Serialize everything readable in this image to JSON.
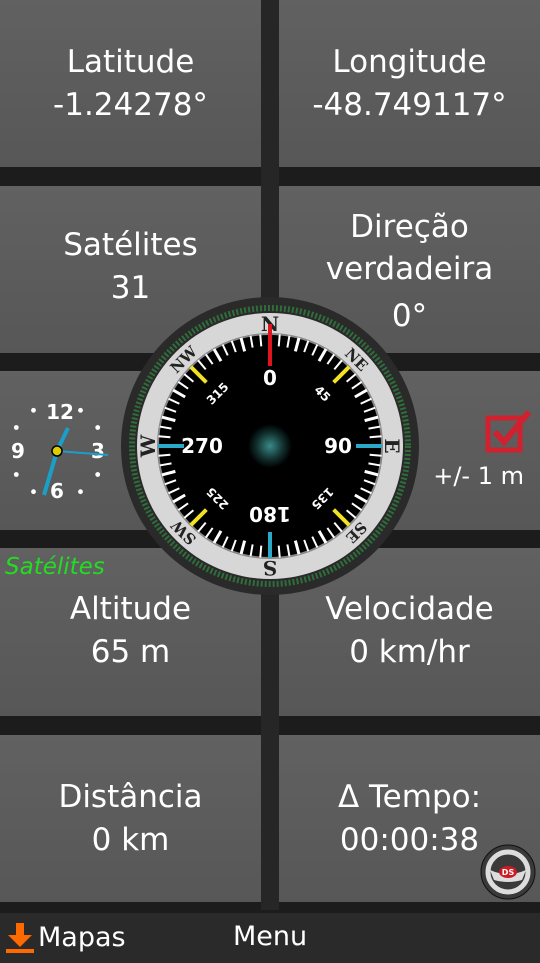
{
  "tiles": {
    "latitude": {
      "label": "Latitude",
      "value": "-1.24278°"
    },
    "longitude": {
      "label": "Longitude",
      "value": "-48.749117°"
    },
    "satellites": {
      "label": "Satélites",
      "value": "31"
    },
    "direction": {
      "label_line1": "Direção",
      "label_line2": "verdadeira",
      "value": "0°"
    },
    "altitude": {
      "label": "Altitude",
      "value": "65 m"
    },
    "speed": {
      "label": "Velocidade",
      "value": "0 km/hr"
    },
    "distance": {
      "label": "Distância",
      "value": "0 km"
    },
    "time": {
      "label": "Δ Tempo:",
      "value": "00:00:38"
    }
  },
  "accuracy": {
    "text": "+/- 1 m",
    "checked": true
  },
  "satellites_link": "Satélites",
  "compass": {
    "heading_deg": 0,
    "cardinals": [
      "N",
      "E",
      "S",
      "W"
    ],
    "intercardinals": [
      "NE",
      "SE",
      "SW",
      "NW"
    ],
    "degree_labels": [
      "0",
      "45",
      "90",
      "135",
      "180",
      "225",
      "270",
      "315"
    ]
  },
  "clock": {
    "numbers": [
      "12",
      "3",
      "6",
      "9"
    ]
  },
  "bottom_bar": {
    "maps_label": "Mapas",
    "menu_label": "Menu"
  },
  "icons": {
    "status": "black-orb-icon",
    "checkbox": "checkbox-checked-icon",
    "download": "download-icon",
    "car": "steering-wheel-ds-icon"
  },
  "colors": {
    "tile": "#5e5e5e",
    "background": "#1c1c1c",
    "green_text": "#22dd22",
    "north_red": "#e0141e",
    "check_red": "#d0212e",
    "download_orange": "#ff6a00",
    "cyan": "#2aa9c9",
    "yellow": "#f2e224"
  }
}
